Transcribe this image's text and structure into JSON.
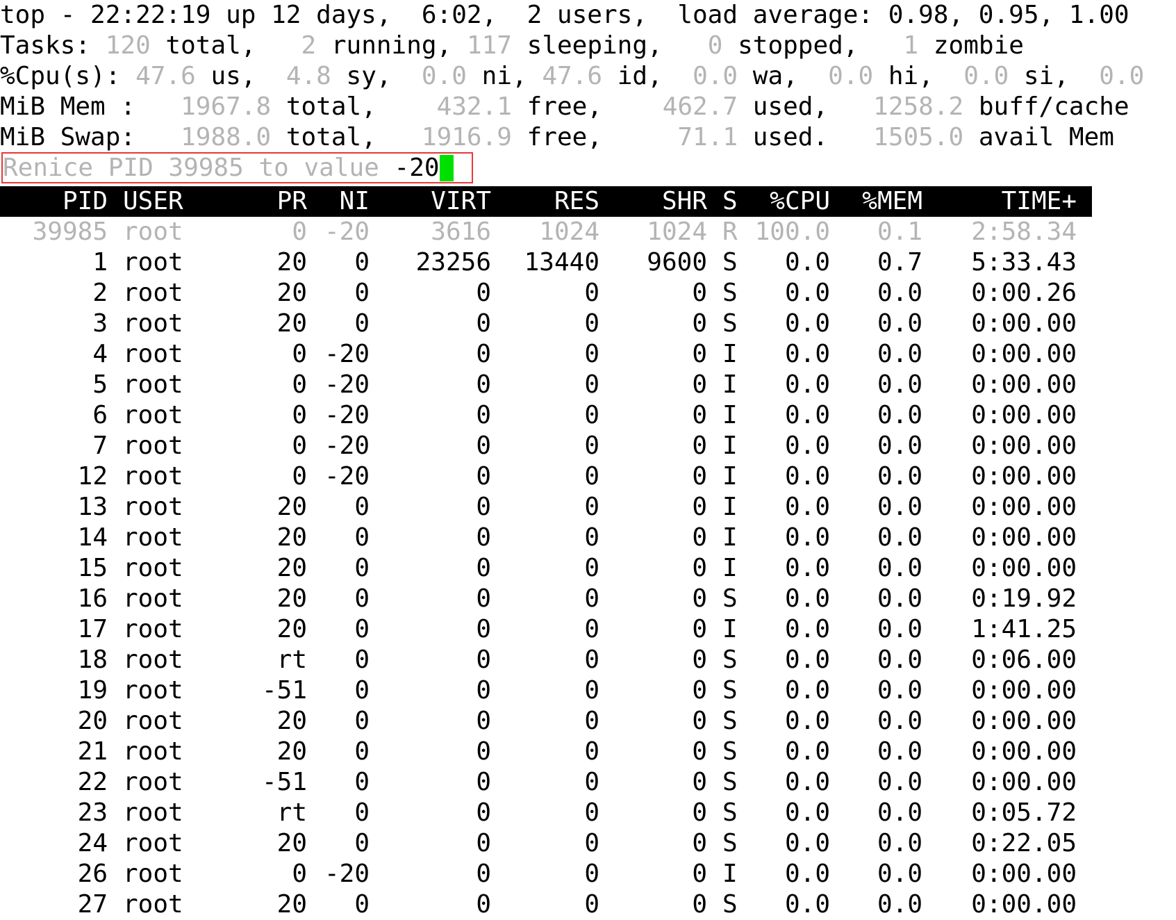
{
  "summary": {
    "line1": "top - 22:22:19 up 12 days,  6:02,  2 users,  load average: 0.98, 0.95, 1.00",
    "tasks": {
      "prefix": "Tasks: ",
      "total": "120",
      "total_label": " total,   ",
      "running": "2",
      "running_label": " running, ",
      "sleeping": "117",
      "sleeping_label": " sleeping,   ",
      "stopped": "0",
      "stopped_label": " stopped,   ",
      "zombie": "1",
      "zombie_label": " zombie"
    },
    "cpu": {
      "prefix": "%Cpu(s): ",
      "us": "47.6",
      "us_label": " us,  ",
      "sy": "4.8",
      "sy_label": " sy,  ",
      "ni": "0.0",
      "ni_label": " ni, ",
      "id": "47.6",
      "id_label": " id,  ",
      "wa": "0.0",
      "wa_label": " wa,  ",
      "hi": "0.0",
      "hi_label": " hi,  ",
      "si": "0.0",
      "si_label": " si,  ",
      "st": "0.0"
    },
    "mem": {
      "prefix": "MiB Mem :   ",
      "total": "1967.8",
      "total_label": " total,    ",
      "free": "432.1",
      "free_label": " free,    ",
      "used": "462.7",
      "used_label": " used,   ",
      "cache": "1258.2",
      "cache_label": " buff/cache"
    },
    "swap": {
      "prefix": "MiB Swap:   ",
      "total": "1988.0",
      "total_label": " total,   ",
      "free": "1916.9",
      "free_label": " free,     ",
      "used": "71.1",
      "used_label": " used.   ",
      "avail": "1505.0",
      "avail_label": " avail Mem"
    }
  },
  "prompt": {
    "label": "Renice PID 39985 to value ",
    "value": "-20"
  },
  "columns": [
    "PID",
    "USER",
    "PR",
    "NI",
    "VIRT",
    "RES",
    "SHR",
    "S",
    "%CPU",
    "%MEM",
    "TIME+"
  ],
  "processes": [
    [
      "39985",
      "root",
      "0",
      "-20",
      "3616",
      "1024",
      "1024",
      "R",
      "100.0",
      "0.1",
      "2:58.34"
    ],
    [
      "1",
      "root",
      "20",
      "0",
      "23256",
      "13440",
      "9600",
      "S",
      "0.0",
      "0.7",
      "5:33.43"
    ],
    [
      "2",
      "root",
      "20",
      "0",
      "0",
      "0",
      "0",
      "S",
      "0.0",
      "0.0",
      "0:00.26"
    ],
    [
      "3",
      "root",
      "20",
      "0",
      "0",
      "0",
      "0",
      "S",
      "0.0",
      "0.0",
      "0:00.00"
    ],
    [
      "4",
      "root",
      "0",
      "-20",
      "0",
      "0",
      "0",
      "I",
      "0.0",
      "0.0",
      "0:00.00"
    ],
    [
      "5",
      "root",
      "0",
      "-20",
      "0",
      "0",
      "0",
      "I",
      "0.0",
      "0.0",
      "0:00.00"
    ],
    [
      "6",
      "root",
      "0",
      "-20",
      "0",
      "0",
      "0",
      "I",
      "0.0",
      "0.0",
      "0:00.00"
    ],
    [
      "7",
      "root",
      "0",
      "-20",
      "0",
      "0",
      "0",
      "I",
      "0.0",
      "0.0",
      "0:00.00"
    ],
    [
      "12",
      "root",
      "0",
      "-20",
      "0",
      "0",
      "0",
      "I",
      "0.0",
      "0.0",
      "0:00.00"
    ],
    [
      "13",
      "root",
      "20",
      "0",
      "0",
      "0",
      "0",
      "I",
      "0.0",
      "0.0",
      "0:00.00"
    ],
    [
      "14",
      "root",
      "20",
      "0",
      "0",
      "0",
      "0",
      "I",
      "0.0",
      "0.0",
      "0:00.00"
    ],
    [
      "15",
      "root",
      "20",
      "0",
      "0",
      "0",
      "0",
      "I",
      "0.0",
      "0.0",
      "0:00.00"
    ],
    [
      "16",
      "root",
      "20",
      "0",
      "0",
      "0",
      "0",
      "S",
      "0.0",
      "0.0",
      "0:19.92"
    ],
    [
      "17",
      "root",
      "20",
      "0",
      "0",
      "0",
      "0",
      "I",
      "0.0",
      "0.0",
      "1:41.25"
    ],
    [
      "18",
      "root",
      "rt",
      "0",
      "0",
      "0",
      "0",
      "S",
      "0.0",
      "0.0",
      "0:06.00"
    ],
    [
      "19",
      "root",
      "-51",
      "0",
      "0",
      "0",
      "0",
      "S",
      "0.0",
      "0.0",
      "0:00.00"
    ],
    [
      "20",
      "root",
      "20",
      "0",
      "0",
      "0",
      "0",
      "S",
      "0.0",
      "0.0",
      "0:00.00"
    ],
    [
      "21",
      "root",
      "20",
      "0",
      "0",
      "0",
      "0",
      "S",
      "0.0",
      "0.0",
      "0:00.00"
    ],
    [
      "22",
      "root",
      "-51",
      "0",
      "0",
      "0",
      "0",
      "S",
      "0.0",
      "0.0",
      "0:00.00"
    ],
    [
      "23",
      "root",
      "rt",
      "0",
      "0",
      "0",
      "0",
      "S",
      "0.0",
      "0.0",
      "0:05.72"
    ],
    [
      "24",
      "root",
      "20",
      "0",
      "0",
      "0",
      "0",
      "S",
      "0.0",
      "0.0",
      "0:22.05"
    ],
    [
      "26",
      "root",
      "0",
      "-20",
      "0",
      "0",
      "0",
      "I",
      "0.0",
      "0.0",
      "0:00.00"
    ],
    [
      "27",
      "root",
      "20",
      "0",
      "0",
      "0",
      "0",
      "S",
      "0.0",
      "0.0",
      "0:00.00"
    ]
  ],
  "colors": {
    "dim": "#b4b4b4",
    "header_bg": "#000000",
    "header_fg": "#ffffff",
    "cursor": "#00e000",
    "highlight_box": "#e53935"
  }
}
